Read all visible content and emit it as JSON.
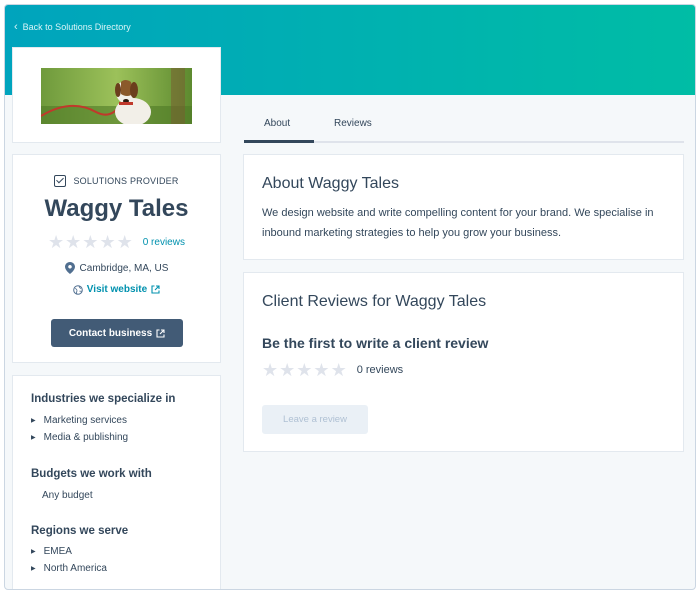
{
  "nav": {
    "back_label": "Back to Solutions Directory"
  },
  "tabs": [
    {
      "label": "About",
      "active": true
    },
    {
      "label": "Reviews",
      "active": false
    }
  ],
  "profile": {
    "badge": "SOLUTIONS PROVIDER",
    "name": "Waggy Tales",
    "rating": 0,
    "reviews_link": "0 reviews",
    "location": "Cambridge, MA, US",
    "website_label": "Visit website",
    "contact_label": "Contact business"
  },
  "details": {
    "industries_heading": "Industries we specialize in",
    "industries": [
      "Marketing services",
      "Media & publishing"
    ],
    "budgets_heading": "Budgets we work with",
    "budgets": [
      "Any budget"
    ],
    "regions_heading": "Regions we serve",
    "regions": [
      "EMEA",
      "North America"
    ]
  },
  "about": {
    "title": "About Waggy Tales",
    "text": "We design website and write compelling content for your brand. We specialise in inbound marketing strategies to help you grow your business."
  },
  "reviews": {
    "title": "Client Reviews for Waggy Tales",
    "empty_heading": "Be the first to write a client review",
    "rating": 0,
    "count_label": "0 reviews",
    "leave_label": "Leave a review"
  },
  "colors": {
    "banner_start": "#00a4bd",
    "banner_end": "#00bda5",
    "primary_button": "#425b76",
    "link": "#0091ae",
    "text": "#33475b"
  },
  "icons": [
    "chevron-left-icon",
    "checkbox-icon",
    "star-icon",
    "location-pin-icon",
    "globe-icon",
    "external-link-icon"
  ]
}
